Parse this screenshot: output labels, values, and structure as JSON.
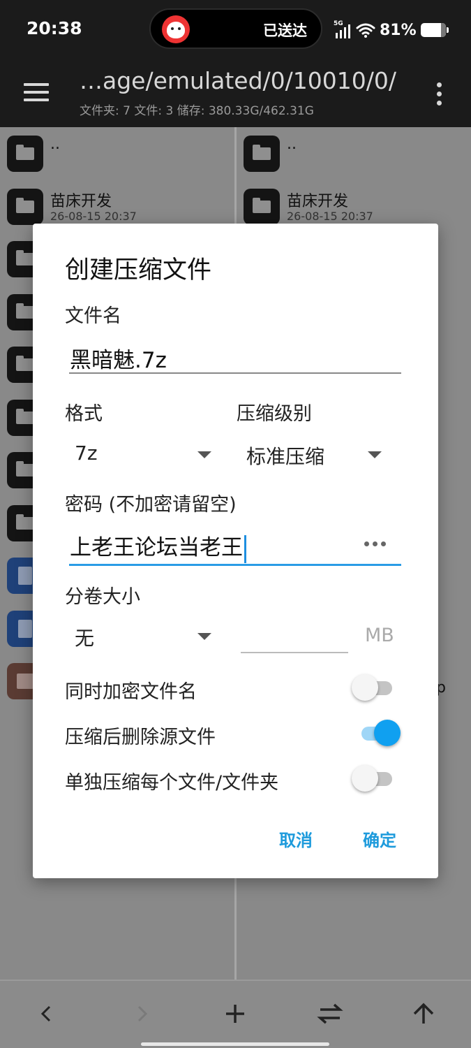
{
  "status_bar": {
    "time": "20:38",
    "island_text": "已送达",
    "network": "5G",
    "battery": "81%",
    "battery_level": 0.81
  },
  "app_bar": {
    "path": "…age/emulated/0/10010/0/",
    "info": "文件夹: 7  文件: 3  储存: 380.33G/462.31G"
  },
  "left_pane": {
    "items": [
      {
        "name": "..",
        "date": "",
        "type": "folder"
      },
      {
        "name": "苗床开发",
        "date": "26-08-15 20:37",
        "type": "folder"
      },
      {
        "name": "",
        "date": "",
        "type": "folder"
      },
      {
        "name": "",
        "date": "",
        "type": "folder"
      },
      {
        "name": "",
        "date": "",
        "type": "folder"
      },
      {
        "name": "",
        "date": "",
        "type": "folder"
      },
      {
        "name": "",
        "date": "",
        "type": "folder"
      },
      {
        "name": "",
        "date": "",
        "type": "folder"
      },
      {
        "name": "",
        "date": "",
        "type": "document"
      },
      {
        "name": "",
        "date": "",
        "type": "document"
      },
      {
        "name": "",
        "date": "",
        "type": "archive"
      }
    ]
  },
  "right_pane": {
    "items": [
      {
        "name": "..",
        "date": "",
        "type": "folder"
      },
      {
        "name": "苗床开发",
        "date": "26-08-15 20:37",
        "type": "folder"
      }
    ],
    "peek_text": "p"
  },
  "dialog": {
    "title": "创建压缩文件",
    "filename_label": "文件名",
    "filename_value": "黑暗魅.7z",
    "format_label": "格式",
    "format_value": "7z",
    "level_label": "压缩级别",
    "level_value": "标准压缩",
    "password_label": "密码 (不加密请留空)",
    "password_value": "上老王论坛当老王",
    "split_label": "分卷大小",
    "split_value": "无",
    "split_size_value": "",
    "split_unit": "MB",
    "toggles": [
      {
        "label": "同时加密文件名",
        "on": false
      },
      {
        "label": "压缩后删除源文件",
        "on": true
      },
      {
        "label": "单独压缩每个文件/文件夹",
        "on": false
      }
    ],
    "cancel_label": "取消",
    "ok_label": "确定"
  },
  "bottom_bar": {
    "back_icon": "chevron-left-icon",
    "forward_icon": "chevron-right-icon",
    "add_icon": "plus-icon",
    "swap_icon": "swap-icon",
    "up_icon": "arrow-up-icon"
  },
  "colors": {
    "accent": "#10a0f0",
    "button_text": "#1e9bdc",
    "status_bar_bg": "#1b1b1b"
  }
}
